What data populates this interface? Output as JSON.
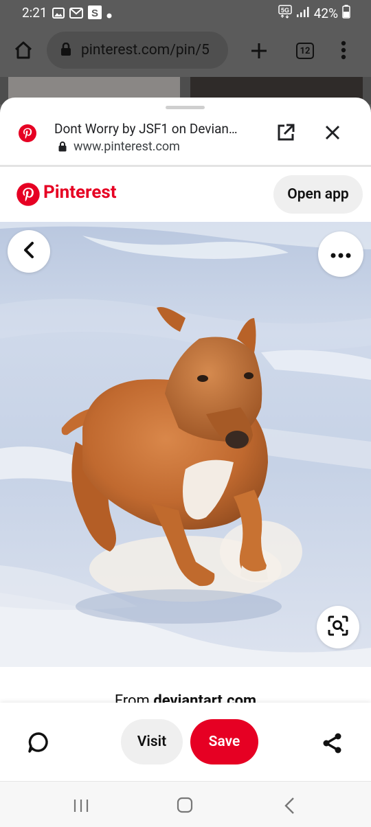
{
  "status_bar": {
    "time": "2:21",
    "battery": "42%",
    "network": "5G"
  },
  "browser": {
    "url": "pinterest.com/pin/5",
    "tab_count": "12"
  },
  "sheet": {
    "title": "Dont Worry by JSF1 on Devian…",
    "url": "www.pinterest.com"
  },
  "pinterest": {
    "brand": "Pinterest",
    "open_app": "Open app",
    "brand_color": "#e60023"
  },
  "pin": {
    "from_prefix": "From ",
    "from_domain": "deviantart.com"
  },
  "actions": {
    "visit": "Visit",
    "save": "Save"
  },
  "icons": {
    "status": [
      "gallery-icon",
      "gmail-icon",
      "s-app-icon",
      "dot-icon",
      "5g-icon",
      "signal-icon",
      "battery-icon"
    ],
    "browser": [
      "home-icon",
      "lock-icon",
      "plus-icon",
      "tab-switcher-icon",
      "more-vert-icon"
    ],
    "sheet": [
      "pinterest-icon",
      "open-external-icon",
      "close-icon"
    ],
    "image": [
      "back-icon",
      "more-horiz-icon",
      "visual-search-icon"
    ],
    "actions": [
      "comment-icon",
      "share-icon"
    ],
    "nav": [
      "recents-icon",
      "home-nav-icon",
      "back-nav-icon"
    ]
  }
}
